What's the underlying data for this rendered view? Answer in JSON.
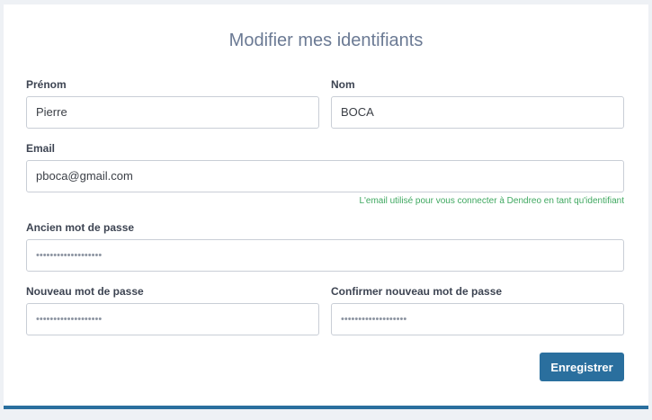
{
  "form": {
    "title": "Modifier mes identifiants",
    "first_name": {
      "label": "Prénom",
      "value": "Pierre"
    },
    "last_name": {
      "label": "Nom",
      "value": "BOCA"
    },
    "email": {
      "label": "Email",
      "value": "pboca@gmail.com",
      "hint": "L'email utilisé pour vous connecter à Dendreo en tant qu'identifiant"
    },
    "old_password": {
      "label": "Ancien mot de passe",
      "value": "•••••••••••••••••••"
    },
    "new_password": {
      "label": "Nouveau mot de passe",
      "value": "•••••••••••••••••••"
    },
    "confirm_password": {
      "label": "Confirmer nouveau mot de passe",
      "value": "•••••••••••••••••••"
    },
    "submit_label": "Enregistrer"
  },
  "colors": {
    "primary": "#2a6f9e",
    "hint": "#3fa860",
    "title": "#6b7a94"
  }
}
